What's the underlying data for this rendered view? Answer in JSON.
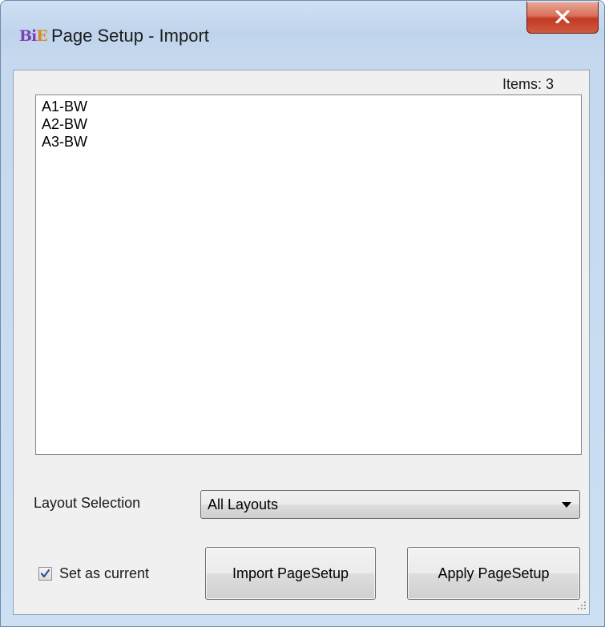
{
  "window": {
    "title": "Page Setup - Import",
    "icon": "bie-app-icon",
    "close_icon": "close-icon"
  },
  "items_count_label": "Items: 3",
  "list": {
    "items": [
      "A1-BW",
      "A2-BW",
      "A3-BW"
    ]
  },
  "layout_selection": {
    "label": "Layout Selection",
    "selected": "All Layouts"
  },
  "set_as_current": {
    "label": "Set as current",
    "checked": true
  },
  "buttons": {
    "import": "Import PageSetup",
    "apply": "Apply PageSetup"
  },
  "colors": {
    "close_button": "#c9452c",
    "checkmark": "#2a4f9a",
    "icon_letters": "#7a3fb0"
  }
}
